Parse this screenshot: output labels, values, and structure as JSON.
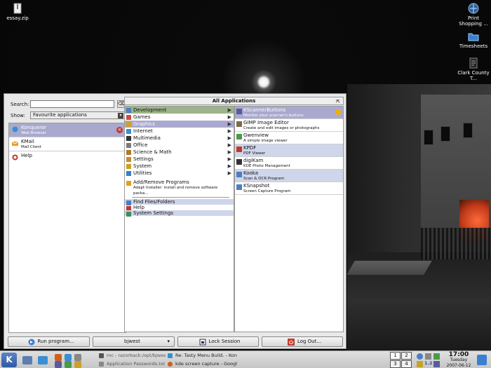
{
  "desktop": {
    "icons": [
      {
        "label": "essay.zip",
        "icon": "zip-file-icon"
      },
      {
        "label": "Print Shopping ...",
        "icon": "globe-icon"
      },
      {
        "label": "Timesheets",
        "icon": "blue-folder-icon"
      },
      {
        "label": "Clark County T...",
        "icon": "document-icon"
      }
    ]
  },
  "menu": {
    "search_label": "Search:",
    "search_value": "",
    "show_label": "Show:",
    "show_value": "Favourite applications",
    "header": "All Applications",
    "favourites": [
      {
        "name": "Konqueror",
        "desc": "Web Browser",
        "selected": true
      },
      {
        "name": "KMail",
        "desc": "Mail Client",
        "selected": false
      },
      {
        "name": "Help",
        "desc": "",
        "selected": false
      }
    ],
    "categories": [
      {
        "label": "Development",
        "state": "sel",
        "arrow": true,
        "color": "#4a7fc1"
      },
      {
        "label": "Games",
        "state": "",
        "arrow": true,
        "color": "#d24a3a"
      },
      {
        "label": "Graphics",
        "state": "hl",
        "arrow": true,
        "color": "#c9a227"
      },
      {
        "label": "Internet",
        "state": "",
        "arrow": true,
        "color": "#3a8fd2"
      },
      {
        "label": "Multimedia",
        "state": "",
        "arrow": true,
        "color": "#333333"
      },
      {
        "label": "Office",
        "state": "",
        "arrow": true,
        "color": "#7a7a7a"
      },
      {
        "label": "Science & Math",
        "state": "",
        "arrow": true,
        "color": "#b07a2a"
      },
      {
        "label": "Settings",
        "state": "",
        "arrow": true,
        "color": "#c98b2a"
      },
      {
        "label": "System",
        "state": "",
        "arrow": true,
        "color": "#c9a227"
      },
      {
        "label": "Utilities",
        "state": "",
        "arrow": true,
        "color": "#3a7fc1"
      }
    ],
    "actions": [
      {
        "label": "Add/Remove Programs",
        "desc": "Adapt Installer: install and remove software packa...",
        "color": "#e0a020",
        "blue": false
      },
      {
        "label": "Find Files/Folders",
        "desc": "",
        "color": "#4a7fc1",
        "blue": true
      },
      {
        "label": "Help",
        "desc": "",
        "color": "#c0392b",
        "blue": false
      },
      {
        "label": "System Settings",
        "desc": "",
        "color": "#3a8f5a",
        "blue": true
      }
    ],
    "apps": [
      {
        "name": "KScannerButtons",
        "desc": "Monitor your scanner's buttons",
        "state": "sel",
        "color": "#5a5aa0"
      },
      {
        "name": "GIMP Image Editor",
        "desc": "Create and edit images or photographs",
        "state": "",
        "color": "#7a6a4a"
      },
      {
        "name": "Gwenview",
        "desc": "A simple image viewer",
        "state": "",
        "color": "#4a9a4a"
      },
      {
        "name": "KPDF",
        "desc": "PDF Viewer",
        "state": "blue",
        "color": "#c0392b"
      },
      {
        "name": "digiKam",
        "desc": "KDE Photo Management",
        "state": "",
        "color": "#333333"
      },
      {
        "name": "Kooka",
        "desc": "Scan & OCR Program",
        "state": "blue",
        "color": "#4a7fc1"
      },
      {
        "name": "KSnapshot",
        "desc": "Screen Capture Program",
        "state": "",
        "color": "#4a7fc1"
      }
    ],
    "buttons": {
      "run": "Run program...",
      "user": "bjwest",
      "lock": "Lock Session",
      "logout": "Log Out..."
    }
  },
  "taskbar": {
    "start_label": "K",
    "tasks": [
      {
        "label": "mc - razorback:/opt/bjwest",
        "dim": true,
        "color": "#555555"
      },
      {
        "label": "Re: Tasty Menu Build. - Kon",
        "dim": false,
        "color": "#3a8fd2"
      },
      {
        "label": "Application Passwords.txt",
        "dim": true,
        "color": "#888888"
      },
      {
        "label": "kde screen capture - Googl",
        "dim": false,
        "color": "#d06020"
      }
    ],
    "pager": [
      "1",
      "2",
      "3",
      "4"
    ],
    "tray_text": "1.2",
    "clock": {
      "time": "17:00",
      "day": "Tuesday",
      "date": "2007-06-12"
    }
  }
}
